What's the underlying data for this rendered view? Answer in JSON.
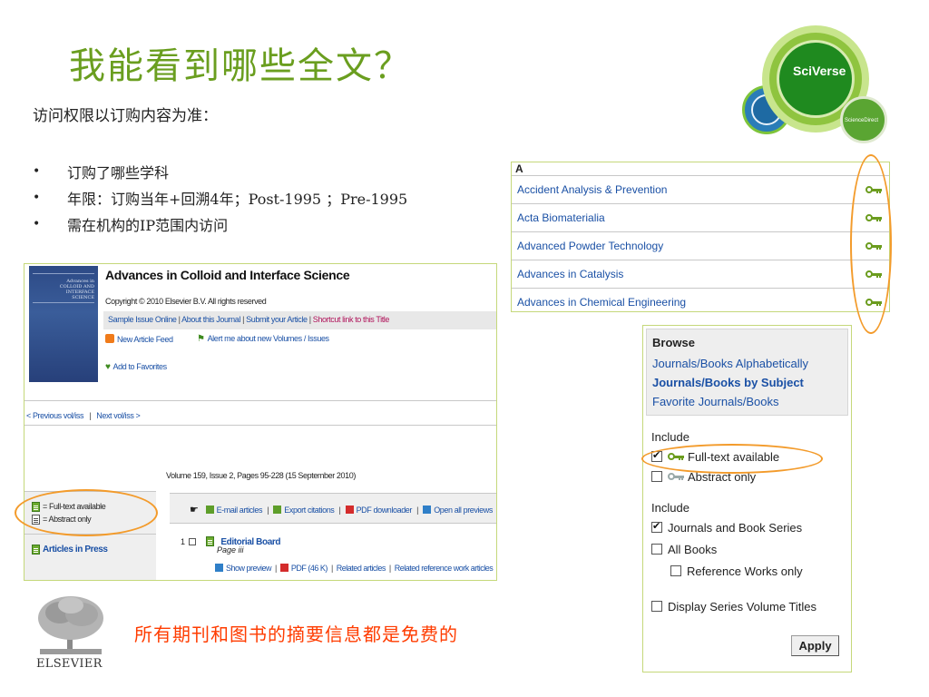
{
  "slide": {
    "title": "我能看到哪些全文？",
    "subtitle": "访问权限以订购内容为准：",
    "bullets": [
      "订购了哪些学科",
      "年限：订购当年+回溯4年；Post-1995 ；Pre-1995",
      "需在机构的IP范围内访问"
    ],
    "bullet_char": "•",
    "bottom_note": "所有期刊和图书的摘要信息都是免费的"
  },
  "logos": {
    "sciverse": "SciVerse",
    "sciencedirect": "ScienceDirect",
    "elsevier": "ELSEVIER"
  },
  "journal_list": {
    "letter": "A",
    "items": [
      {
        "name": "Accident Analysis & Prevention",
        "icon": "key-icon"
      },
      {
        "name": "Acta Biomaterialia",
        "icon": "key-icon"
      },
      {
        "name": "Advanced Powder Technology",
        "icon": "key-icon"
      },
      {
        "name": "Advances in Catalysis",
        "icon": "key-icon"
      },
      {
        "name": "Advances in Chemical Engineering",
        "icon": "key-icon"
      }
    ]
  },
  "browse": {
    "title": "Browse",
    "links": [
      {
        "label": "Journals/Books Alphabetically",
        "bold": false
      },
      {
        "label": "Journals/Books by Subject",
        "bold": true
      },
      {
        "label": "Favorite Journals/Books",
        "bold": false
      }
    ],
    "include_label_1": "Include",
    "fulltext_label": "Full-text available",
    "fulltext_checked": true,
    "abstract_label": "Abstract only",
    "abstract_checked": false,
    "include_label_2": "Include",
    "journals_series_label": "Journals and Book Series",
    "journals_series_checked": true,
    "all_books_label": "All Books",
    "all_books_checked": false,
    "reference_label": "Reference Works only",
    "reference_checked": false,
    "display_titles_label": "Display Series Volume Titles",
    "display_titles_checked": false,
    "apply_label": "Apply"
  },
  "journal_page": {
    "cover_text": "Advances in COLLOID AND INTERFACE SCIENCE",
    "title": "Advances in Colloid and Interface Science",
    "copyright": "Copyright © 2010 Elsevier B.V. All rights reserved",
    "links": [
      "Sample Issue Online",
      "About this Journal",
      "Submit your Article"
    ],
    "shortcut_link": "Shortcut link to this Title",
    "new_article_feed": "New Article Feed",
    "alert_me": "Alert me about new Volumes / Issues",
    "add_favorites": "Add to Favorites",
    "prev_link": "< Previous vol/iss",
    "next_link": "Next vol/iss >",
    "nav_sep": "|",
    "volume_info": "Volume 159, Issue 2, Pages 95-228 (15 September 2010)",
    "legend_fulltext": "= Full-text available",
    "legend_abstract": "= Abstract only",
    "articles_in_press": "Articles in Press",
    "toolbar": [
      "E-mail articles",
      "Export citations",
      "PDF downloader",
      "Open all previews"
    ],
    "article": {
      "number": "1",
      "title": "Editorial Board",
      "page": "Page iii",
      "show_preview": "Show preview",
      "pdf": "PDF (46 K)",
      "related": "Related articles",
      "related_ref": "Related reference work articles"
    }
  },
  "colors": {
    "title_green": "#6a9e1f",
    "link_blue": "#1a50a5",
    "key_green": "#6b9c1e",
    "oval_orange": "#f39b2b",
    "note_red": "#ff3c00"
  }
}
